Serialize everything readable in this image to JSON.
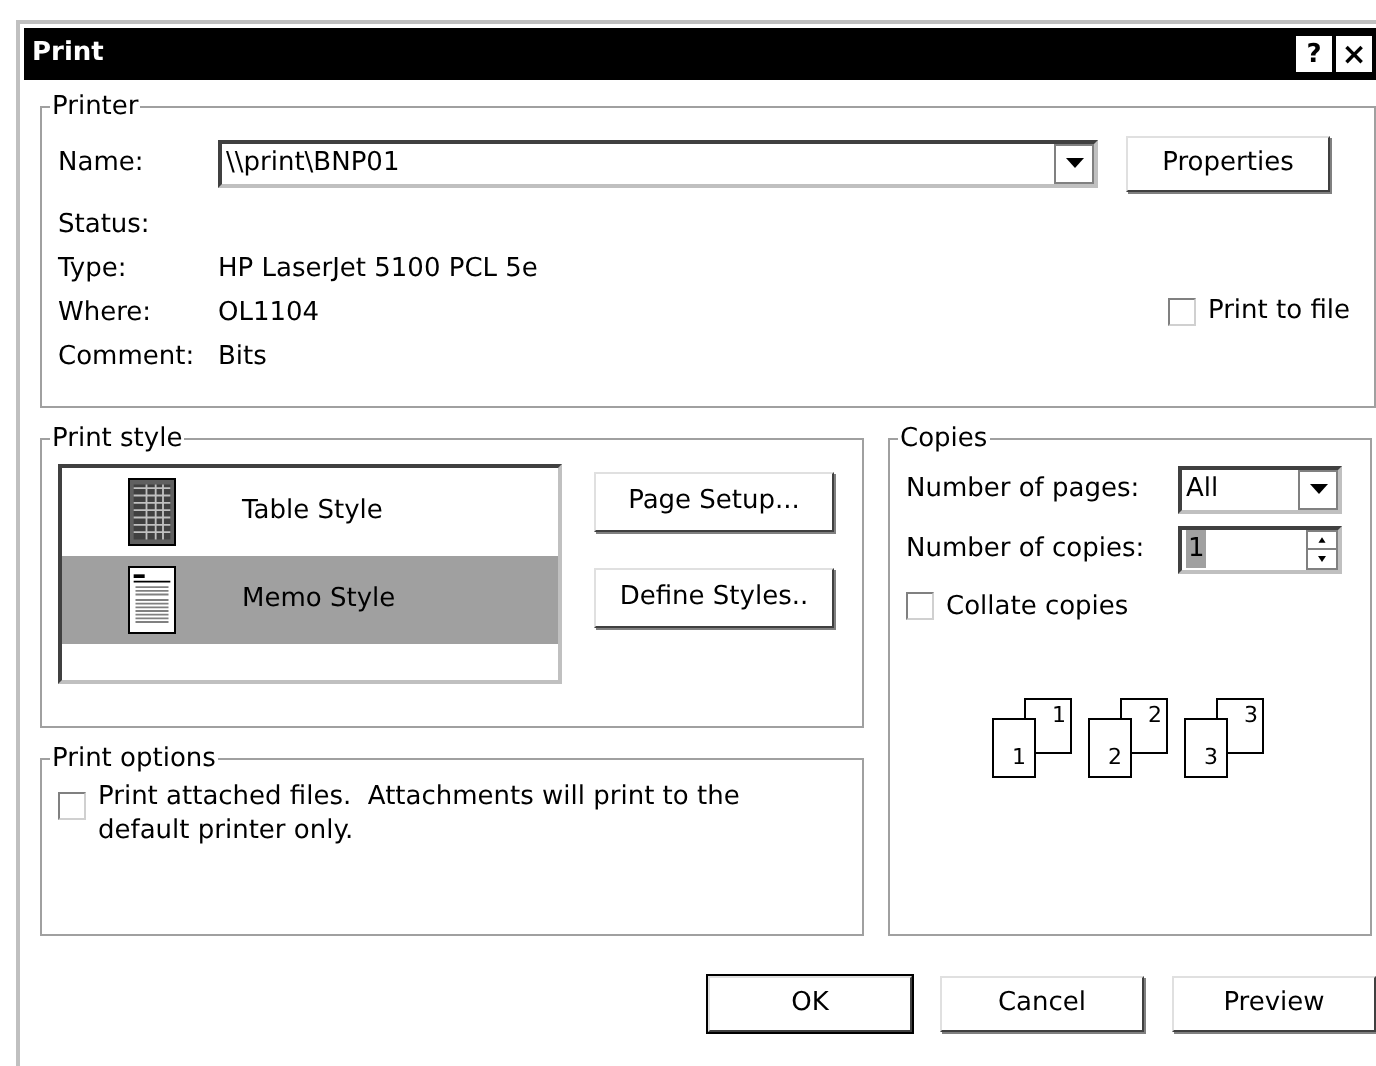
{
  "window": {
    "title": "Print",
    "help_button": "?",
    "close_button": "×"
  },
  "printer": {
    "legend": "Printer",
    "name_label": "Name:",
    "name_value": "\\\\print\\BNP01",
    "properties_button": "Properties",
    "info": [
      {
        "label": "Status:"
      },
      {
        "label": "Type:",
        "value": "HP LaserJet 5100 PCL 5e"
      },
      {
        "label": "Where:",
        "value": "OL1104"
      },
      {
        "label": "Comment:",
        "value": "Bits"
      }
    ],
    "print_to_file": {
      "label": "Print to file",
      "checked": false
    }
  },
  "print_style": {
    "legend": "Print style",
    "styles": [
      {
        "kind": "table",
        "label": "Table Style",
        "selected": false
      },
      {
        "kind": "memo",
        "label": "Memo Style",
        "selected": true
      }
    ],
    "buttons": [
      "Page Setup...",
      "Define Styles.."
    ]
  },
  "copies": {
    "legend": "Copies",
    "pages_label": "Number of pages:",
    "pages_value": "All",
    "copies_label": "Number of copies:",
    "copies_value": "1",
    "collate": {
      "label": "Collate copies",
      "checked": false
    },
    "collate_sets": [
      {
        "front": "1",
        "back": "1"
      },
      {
        "front": "2",
        "back": "2"
      },
      {
        "front": "3",
        "back": "3"
      }
    ]
  },
  "print_options": {
    "legend": "Print options",
    "attach": {
      "label": "Print attached files.  Attachments will print to the default printer only.",
      "checked": false
    }
  },
  "buttons": [
    {
      "label": "OK",
      "default": true
    },
    {
      "label": "Cancel",
      "default": false
    },
    {
      "label": "Preview",
      "default": false
    }
  ]
}
